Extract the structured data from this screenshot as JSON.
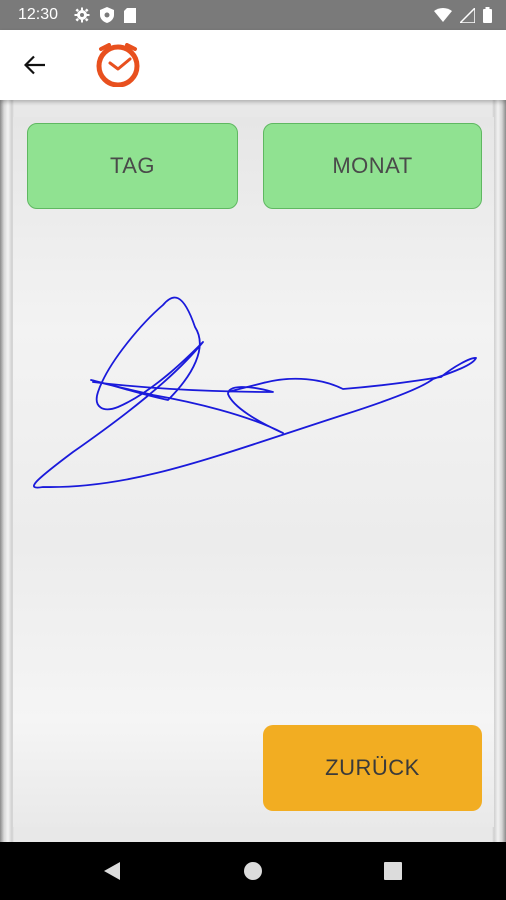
{
  "status_bar": {
    "time": "12:30",
    "left_icons": [
      "gear-icon",
      "shield-icon",
      "sd-card-icon"
    ],
    "right_icons": [
      "wifi-icon",
      "signal-icon",
      "battery-icon"
    ]
  },
  "app_bar": {
    "back_icon": "arrow-left-icon",
    "logo_icon": "clock-logo-icon",
    "logo_color": "#e8501e"
  },
  "buttons": {
    "day_label": "TAG",
    "month_label": "MONAT",
    "back_label": "ZURÜCK"
  },
  "colors": {
    "green_button": "#90e291",
    "orange_button": "#f2ad22",
    "signature_ink": "#1a1adb"
  },
  "nav_bar": {
    "back_icon": "triangle-back-icon",
    "home_icon": "circle-home-icon",
    "recents_icon": "square-recents-icon"
  }
}
